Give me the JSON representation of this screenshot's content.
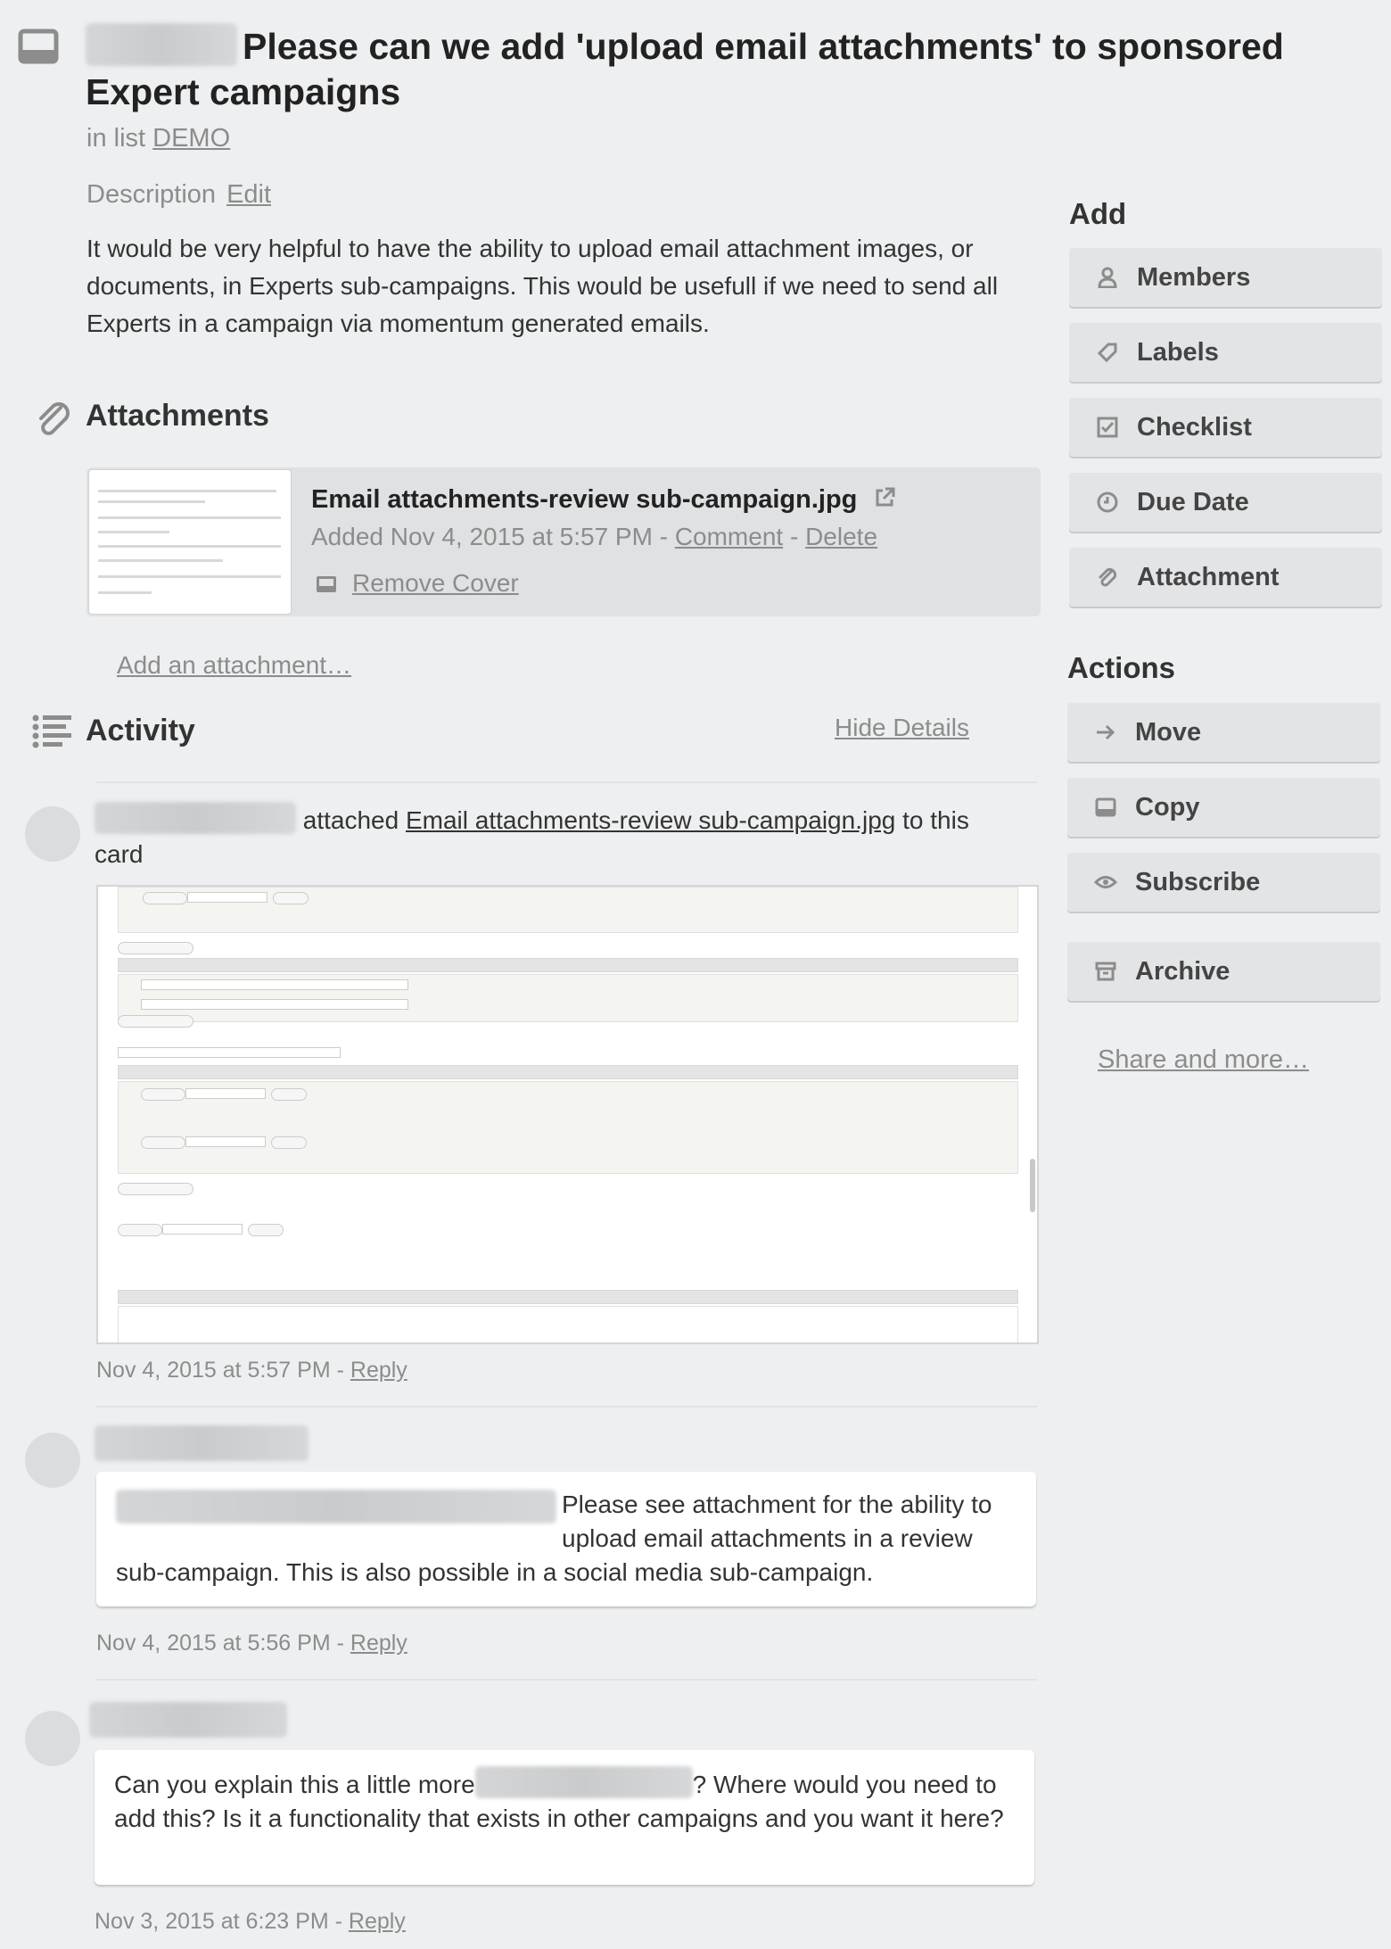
{
  "header": {
    "title": "Please can we add 'upload email attachments' to sponsored Expert campaigns",
    "in_list_prefix": "in list",
    "list_name": "DEMO"
  },
  "description": {
    "heading": "Description",
    "edit_label": "Edit",
    "text": "It would be very helpful to have the ability to upload email attachment images, or documents, in Experts sub-campaigns. This would be usefull if we need to send all Experts in a campaign via momentum generated emails."
  },
  "attachments": {
    "heading": "Attachments",
    "item": {
      "filename": "Email attachments-review sub-campaign.jpg",
      "added": "Added Nov 4, 2015 at 5:57 PM -",
      "comment_label": "Comment",
      "separator": "-",
      "delete_label": "Delete",
      "remove_cover_label": "Remove Cover"
    },
    "add_label": "Add an attachment…"
  },
  "activity": {
    "heading": "Activity",
    "hide_details_label": "Hide Details",
    "entries": [
      {
        "type": "attachment",
        "verb": "attached",
        "filename": "Email attachments-review sub-campaign.jpg",
        "suffix": "to this",
        "suffix2": "card",
        "timestamp": "Nov 4, 2015 at 5:57 PM -",
        "reply_label": "Reply"
      },
      {
        "type": "comment",
        "text": "Please see attachment for the ability to upload email attachments in a review sub-campaign. This is also possible in a social media sub-campaign.",
        "timestamp": "Nov 4, 2015 at 5:56 PM -",
        "reply_label": "Reply"
      },
      {
        "type": "comment",
        "text_a": "Can you explain this a little more",
        "text_b": "? Where would you need to add this? Is it a functionality that exists in other campaigns and you want it here?",
        "timestamp": "Nov 3, 2015 at 6:23 PM -",
        "reply_label": "Reply"
      }
    ]
  },
  "sidebar": {
    "add_heading": "Add",
    "add_buttons": [
      {
        "label": "Members",
        "icon": "person-icon"
      },
      {
        "label": "Labels",
        "icon": "tag-icon"
      },
      {
        "label": "Checklist",
        "icon": "checkbox-icon"
      },
      {
        "label": "Due Date",
        "icon": "clock-icon"
      },
      {
        "label": "Attachment",
        "icon": "paperclip-icon"
      }
    ],
    "actions_heading": "Actions",
    "action_buttons": [
      {
        "label": "Move",
        "icon": "arrow-right-icon"
      },
      {
        "label": "Copy",
        "icon": "card-icon"
      },
      {
        "label": "Subscribe",
        "icon": "eye-icon"
      },
      {
        "label": "Archive",
        "icon": "archive-icon"
      }
    ],
    "share_label": "Share and more…"
  },
  "colors": {
    "background": "#edeff0",
    "button": "#e2e4e6",
    "muted_text": "#8c8c8c"
  }
}
